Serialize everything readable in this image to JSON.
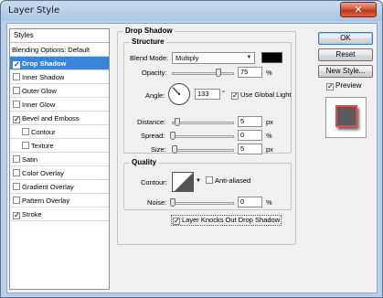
{
  "window": {
    "title": "Layer Style",
    "close_glyph": "✕"
  },
  "styles_panel": {
    "header": "Styles",
    "items": [
      {
        "label": "Blending Options: Default",
        "checkbox": false,
        "checked": false,
        "indent": false,
        "selected": false
      },
      {
        "label": "Drop Shadow",
        "checkbox": true,
        "checked": true,
        "indent": false,
        "selected": true
      },
      {
        "label": "Inner Shadow",
        "checkbox": true,
        "checked": false,
        "indent": false,
        "selected": false
      },
      {
        "label": "Outer Glow",
        "checkbox": true,
        "checked": false,
        "indent": false,
        "selected": false
      },
      {
        "label": "Inner Glow",
        "checkbox": true,
        "checked": false,
        "indent": false,
        "selected": false
      },
      {
        "label": "Bevel and Emboss",
        "checkbox": true,
        "checked": true,
        "indent": false,
        "selected": false
      },
      {
        "label": "Contour",
        "checkbox": true,
        "checked": false,
        "indent": true,
        "selected": false
      },
      {
        "label": "Texture",
        "checkbox": true,
        "checked": false,
        "indent": true,
        "selected": false
      },
      {
        "label": "Satin",
        "checkbox": true,
        "checked": false,
        "indent": false,
        "selected": false
      },
      {
        "label": "Color Overlay",
        "checkbox": true,
        "checked": false,
        "indent": false,
        "selected": false
      },
      {
        "label": "Gradient Overlay",
        "checkbox": true,
        "checked": false,
        "indent": false,
        "selected": false
      },
      {
        "label": "Pattern Overlay",
        "checkbox": true,
        "checked": false,
        "indent": false,
        "selected": false
      },
      {
        "label": "Stroke",
        "checkbox": true,
        "checked": true,
        "indent": false,
        "selected": false
      }
    ]
  },
  "drop_shadow": {
    "title": "Drop Shadow",
    "structure": {
      "title": "Structure",
      "blend_mode_label": "Blend Mode:",
      "blend_mode_value": "Multiply",
      "shadow_color": "#000000",
      "opacity_label": "Opacity:",
      "opacity_value": "75",
      "opacity_unit": "%",
      "opacity_fraction": 0.75,
      "angle_label": "Angle:",
      "angle_value": "133",
      "angle_unit": "°",
      "use_global_light_label": "Use Global Light",
      "use_global_light_checked": true,
      "distance_label": "Distance:",
      "distance_value": "5",
      "distance_unit": "px",
      "spread_label": "Spread:",
      "spread_value": "0",
      "spread_unit": "%",
      "size_label": "Size:",
      "size_value": "5",
      "size_unit": "px"
    },
    "quality": {
      "title": "Quality",
      "contour_label": "Contour:",
      "anti_aliased_label": "Anti-aliased",
      "anti_aliased_checked": false,
      "noise_label": "Noise:",
      "noise_value": "0",
      "noise_unit": "%"
    },
    "knockout_label": "Layer Knocks Out Drop Shadow",
    "knockout_checked": true
  },
  "buttons": {
    "ok": "OK",
    "reset": "Reset",
    "new_style": "New Style...",
    "preview_label": "Preview",
    "preview_checked": true
  },
  "colors": {
    "selection": "#3a86d6",
    "preview_stroke": "#e04a4a",
    "preview_fill": "#5a5a5a"
  }
}
